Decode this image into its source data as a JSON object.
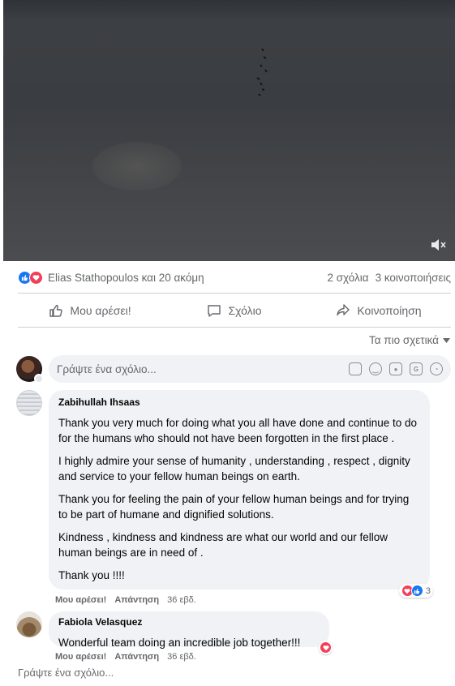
{
  "post": {
    "reactions": {
      "names": "Elias Stathopoulos και 20 ακόμη",
      "comments_count": "2 σχόλια",
      "shares_count": "3 κοινοποιήσεις",
      "types": [
        "like",
        "love"
      ]
    },
    "actions": {
      "like": "Μου αρέσει!",
      "comment": "Σχόλιο",
      "share": "Κοινοποίηση"
    },
    "sort_label": "Τα πιο σχετικά",
    "composer": {
      "placeholder": "Γράψτε ένα σχόλιο..."
    },
    "comments": [
      {
        "author": "Zabihullah Ihsaas",
        "paragraphs": [
          "Thank you very much for doing what you all have done and continue to do for the humans who should not have been forgotten in the first place .",
          "I highly admire your sense of humanity , understanding , respect , dignity and service to your fellow human beings on earth.",
          "Thank you for feeling the pain of your fellow human beings and for trying to be part of humane and dignified solutions.",
          "Kindness , kindness and kindness are what our world and our fellow human beings are in need of .",
          "Thank you !!!!"
        ],
        "like_label": "Μου αρέσει!",
        "reply_label": "Απάντηση",
        "time": "36 εβδ.",
        "reaction_count": "3"
      },
      {
        "author": "Fabiola Velasquez",
        "paragraphs": [
          "Wonderful team doing an incredible job together!!!"
        ],
        "like_label": "Μου αρέσει!",
        "reply_label": "Απάντηση",
        "time": "36 εβδ."
      }
    ],
    "write_comment_link": "Γράψτε ένα σχόλιο..."
  },
  "colors": {
    "like_blue": "#1877f2",
    "love_red": "#f33e58",
    "bubble_bg": "#f0f2f5",
    "secondary_text": "#65676b"
  }
}
